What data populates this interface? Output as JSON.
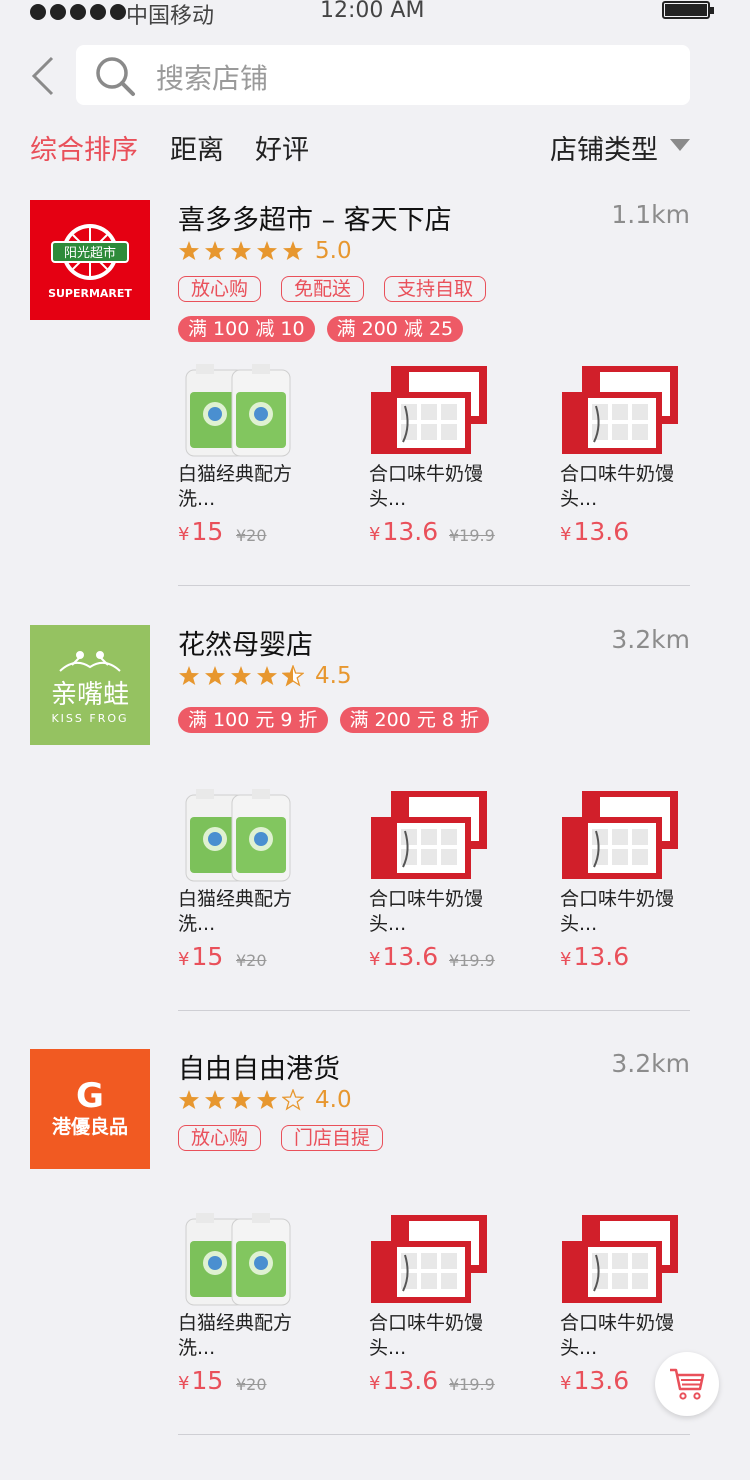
{
  "status_bar": {
    "carrier": "中国移动",
    "time": "12:00 AM"
  },
  "search": {
    "placeholder": "搜索店铺"
  },
  "filters": {
    "sort_comprehensive": "综合排序",
    "distance": "距离",
    "rating": "好评",
    "store_type": "店铺类型"
  },
  "colors": {
    "accent": "#e9505a",
    "star": "#e7972f"
  },
  "stores": [
    {
      "name": "喜多多超市 – 客天下店",
      "distance": "1.1km",
      "rating": 5.0,
      "rating_text": "5.0",
      "logo_text_top": "阳光超市",
      "logo_text_bottom": "SUPERMARET",
      "logo_color": "#e50012",
      "tags": [
        "放心购",
        "免配送",
        "支持自取"
      ],
      "promos": [
        "满 100 减 10",
        "满 200 减 25"
      ],
      "goods": [
        {
          "name": "白猫经典配方洗...",
          "price": "15",
          "old_price": "¥20"
        },
        {
          "name": "合口味牛奶馒头...",
          "price": "13.6",
          "old_price": "¥19.9"
        },
        {
          "name": "合口味牛奶馒头...",
          "price": "13.6",
          "old_price": ""
        }
      ]
    },
    {
      "name": "花然母婴店",
      "distance": "3.2km",
      "rating": 4.5,
      "rating_text": "4.5",
      "logo_text_top": "亲嘴蛙",
      "logo_text_bottom": "KISS FROG",
      "logo_color": "#95c261",
      "tags": [],
      "promos": [
        "满 100 元 9 折",
        "满 200 元 8 折"
      ],
      "goods": [
        {
          "name": "白猫经典配方洗...",
          "price": "15",
          "old_price": "¥20"
        },
        {
          "name": "合口味牛奶馒头...",
          "price": "13.6",
          "old_price": "¥19.9"
        },
        {
          "name": "合口味牛奶馒头...",
          "price": "13.6",
          "old_price": ""
        }
      ]
    },
    {
      "name": "自由自由港货",
      "distance": "3.2km",
      "rating": 4.0,
      "rating_text": "4.0",
      "logo_text_top": "G",
      "logo_text_bottom": "港優良品",
      "logo_color": "#f15a22",
      "tags": [
        "放心购",
        "门店自提"
      ],
      "promos": [],
      "goods": [
        {
          "name": "白猫经典配方洗...",
          "price": "15",
          "old_price": "¥20"
        },
        {
          "name": "合口味牛奶馒头...",
          "price": "13.6",
          "old_price": "¥19.9"
        },
        {
          "name": "合口味牛奶馒头...",
          "price": "13.6",
          "old_price": ""
        }
      ]
    }
  ],
  "currency_symbol": "¥",
  "icons": {
    "back": "chevron-left-icon",
    "search": "search-icon",
    "dropdown": "triangle-down-icon",
    "cart": "cart-icon"
  }
}
